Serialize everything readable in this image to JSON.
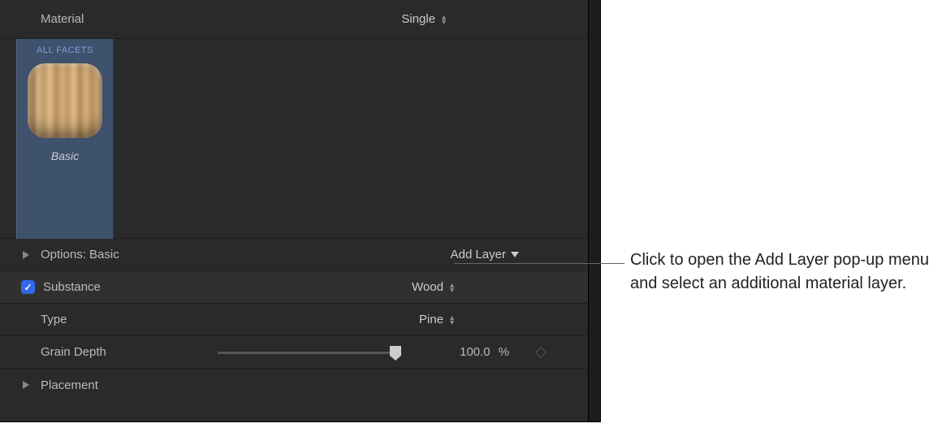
{
  "header": {
    "label": "Material",
    "selector_value": "Single"
  },
  "facet": {
    "tab_label": "ALL FACETS",
    "preset_name": "Basic"
  },
  "options": {
    "label": "Options: Basic",
    "add_layer_label": "Add Layer"
  },
  "substance": {
    "label": "Substance",
    "value": "Wood",
    "checked": true
  },
  "type": {
    "label": "Type",
    "value": "Pine"
  },
  "grain_depth": {
    "label": "Grain Depth",
    "value": "100.0",
    "unit": "%",
    "slider_pct": 100
  },
  "placement": {
    "label": "Placement"
  },
  "callout": {
    "text": "Click to open the Add Layer pop-up menu and select an additional material layer."
  }
}
